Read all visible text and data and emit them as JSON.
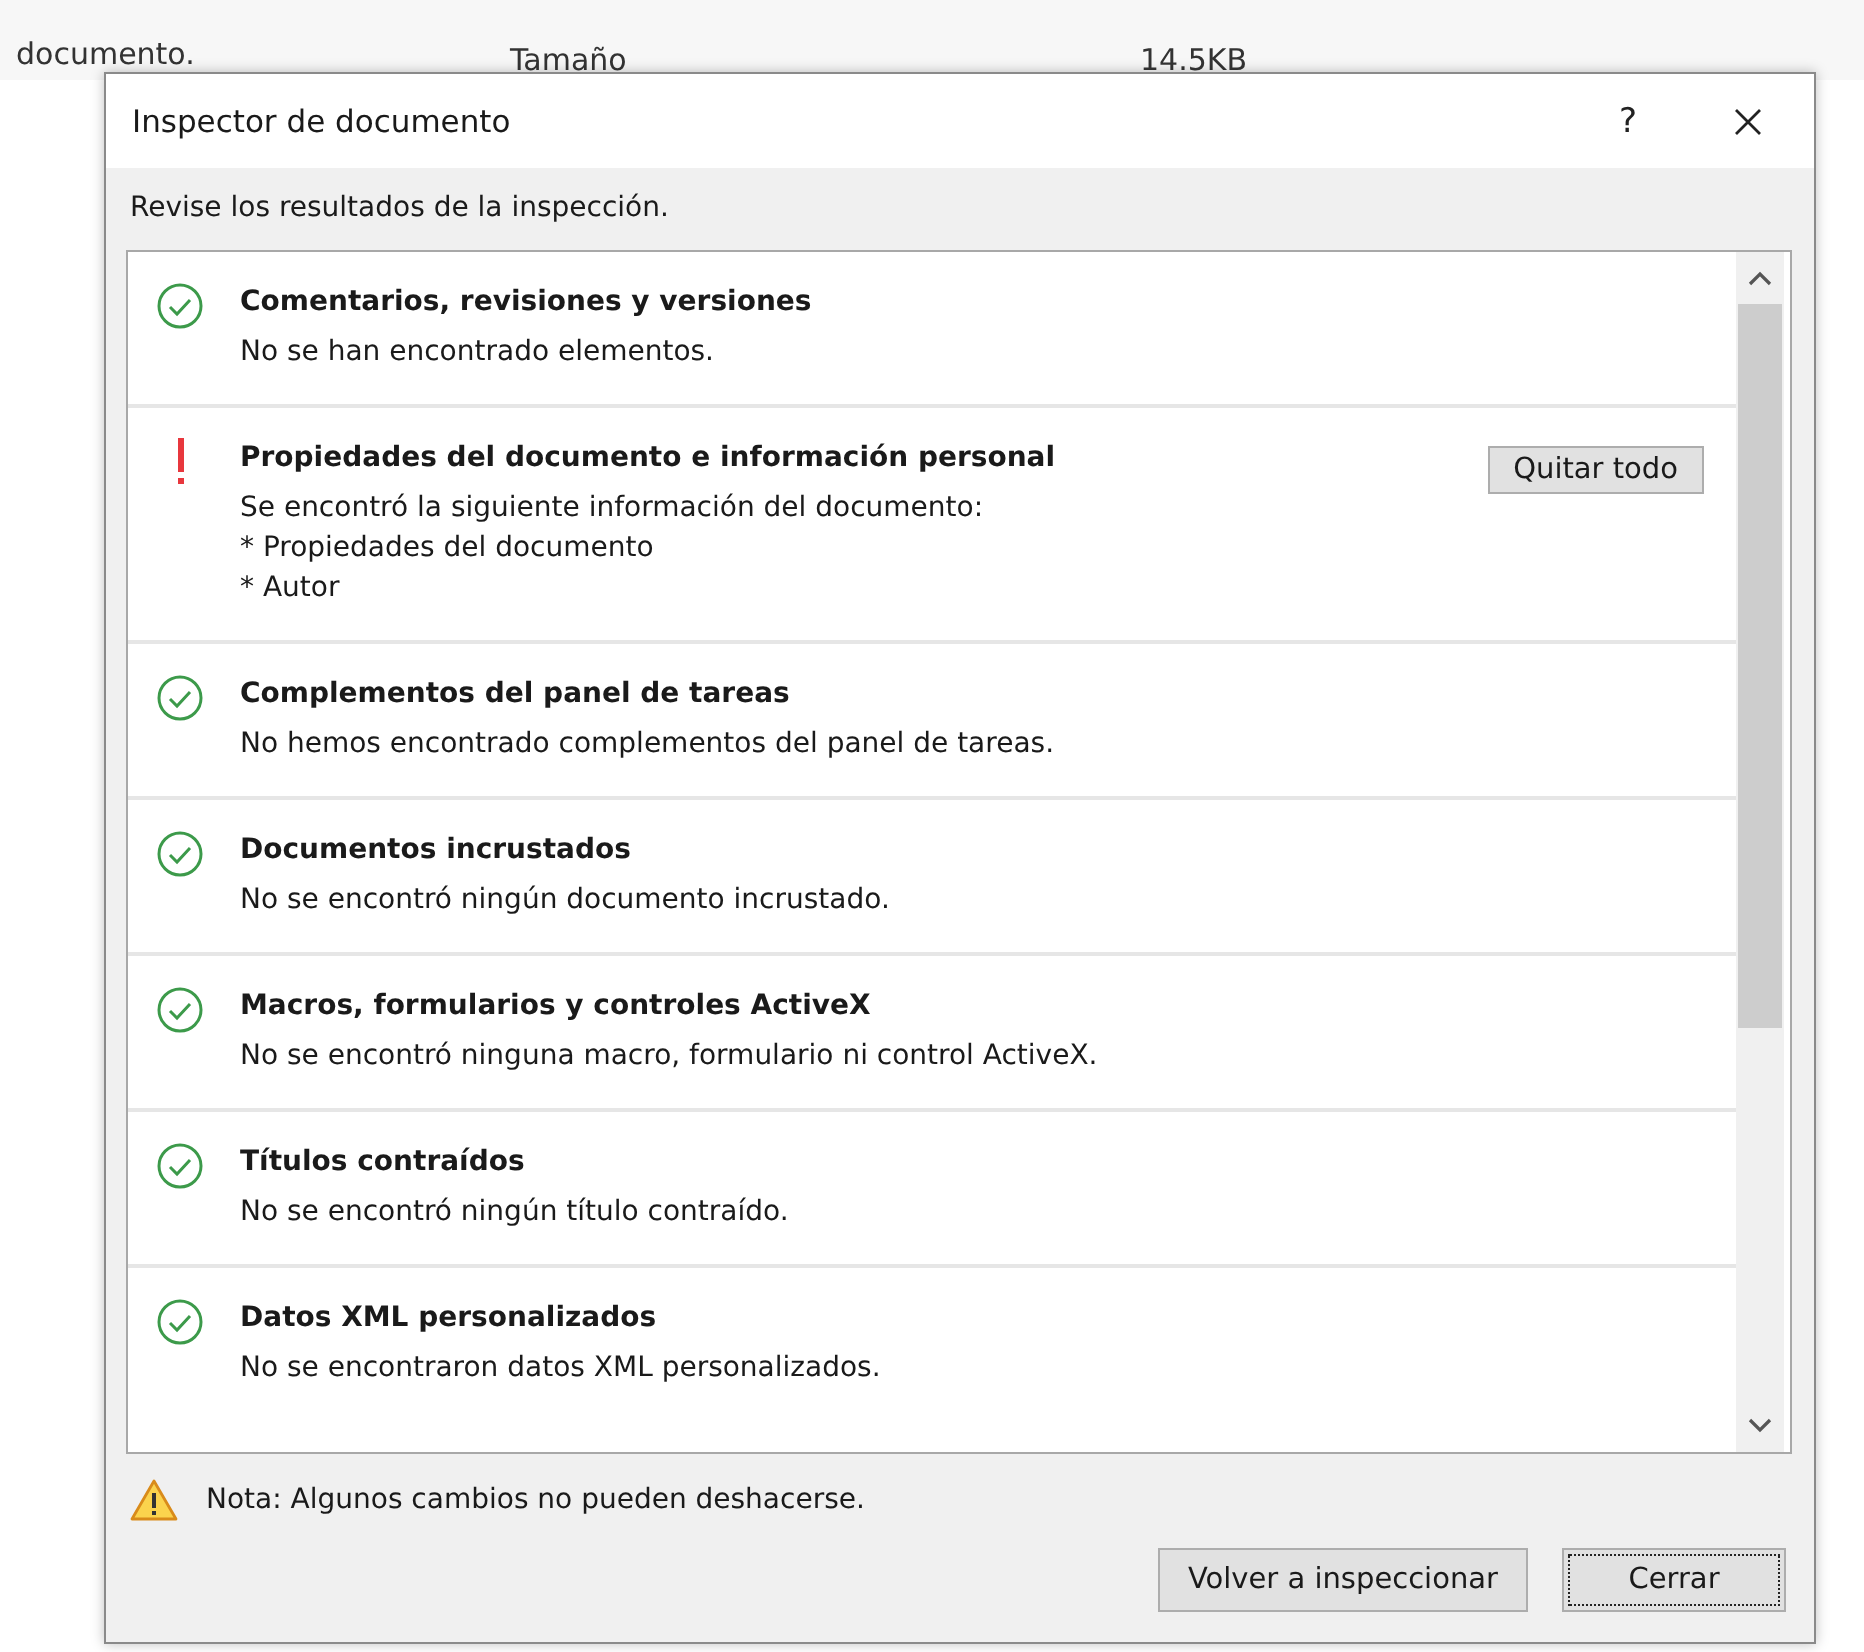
{
  "background": {
    "texts": [
      "documento.",
      "Tamaño",
      "14.5KB"
    ]
  },
  "window": {
    "title": "Inspector de documento",
    "help": "?"
  },
  "intro": "Revise los resultados de la inspección.",
  "results": [
    {
      "kind": "ok",
      "title": "Comentarios, revisiones y versiones",
      "lines": [
        "No se han encontrado elementos."
      ]
    },
    {
      "kind": "warning",
      "title": "Propiedades del documento e información personal",
      "lines": [
        "Se encontró la siguiente información del documento:",
        "* Propiedades del documento",
        "* Autor"
      ],
      "action": "Quitar todo"
    },
    {
      "kind": "ok",
      "title": "Complementos del panel de tareas",
      "lines": [
        "No hemos encontrado complementos del panel de tareas."
      ]
    },
    {
      "kind": "ok",
      "title": "Documentos incrustados",
      "lines": [
        "No se encontró ningún documento incrustado."
      ]
    },
    {
      "kind": "ok",
      "title": "Macros, formularios y controles ActiveX",
      "lines": [
        "No se encontró ninguna macro, formulario ni control ActiveX."
      ]
    },
    {
      "kind": "ok",
      "title": "Títulos contraídos",
      "lines": [
        "No se encontró ningún título contraído."
      ]
    },
    {
      "kind": "ok",
      "title": "Datos XML personalizados",
      "lines": [
        "No se encontraron datos XML personalizados."
      ]
    }
  ],
  "note": "Nota: Algunos cambios no pueden deshacerse.",
  "buttons": [
    {
      "label": "Volver a inspeccionar",
      "focused": false
    },
    {
      "label": "Cerrar",
      "focused": true
    }
  ]
}
